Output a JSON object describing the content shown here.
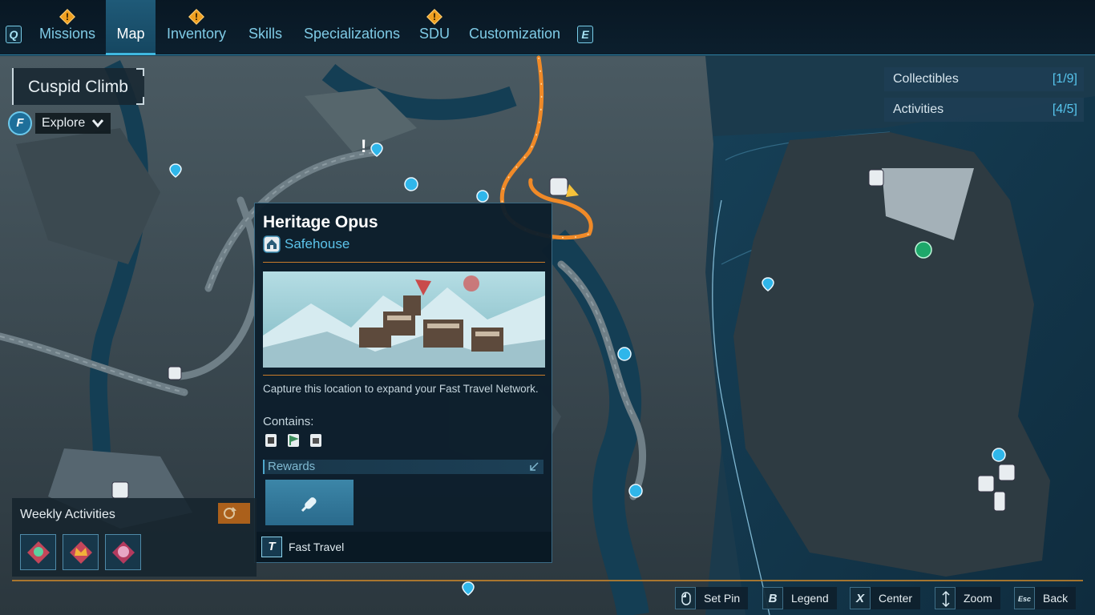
{
  "nav": {
    "left_key": "Q",
    "right_key": "E",
    "tabs": [
      {
        "label": "Missions",
        "alert": true
      },
      {
        "label": "Map",
        "active": true
      },
      {
        "label": "Inventory",
        "alert": true
      },
      {
        "label": "Skills"
      },
      {
        "label": "Specializations"
      },
      {
        "label": "SDU",
        "alert": true
      },
      {
        "label": "Customization"
      }
    ],
    "alert_glyph": "!"
  },
  "location": {
    "name": "Cuspid Climb",
    "filter_key": "F",
    "filter_label": "Explore"
  },
  "tracker": {
    "collectibles_label": "Collectibles",
    "collectibles_value": "[1/9]",
    "activities_label": "Activities",
    "activities_value": "[4/5]"
  },
  "popup": {
    "title": "Heritage Opus",
    "type": "Safehouse",
    "description": "Capture this location to expand your Fast Travel Network.",
    "contains_label": "Contains:",
    "contains_icons": [
      "safehouse-icon",
      "flag-icon",
      "lootbox-icon"
    ],
    "rewards_label": "Rewards",
    "reward_icon": "fast-travel-icon",
    "action_key": "T",
    "action_label": "Fast Travel"
  },
  "weekly": {
    "title": "Weekly Activities",
    "slots": [
      "skull-activity-icon",
      "crown-activity-icon",
      "boss-activity-icon"
    ]
  },
  "hints": [
    {
      "key": "",
      "label": "Set Pin"
    },
    {
      "key": "B",
      "label": "Legend"
    },
    {
      "key": "X",
      "label": "Center"
    },
    {
      "key": "",
      "label": "Zoom"
    },
    {
      "key": "Esc",
      "label": "Back"
    }
  ],
  "colors": {
    "accent": "#3fb8e0",
    "route": "#f08a28",
    "water": "#123448"
  }
}
